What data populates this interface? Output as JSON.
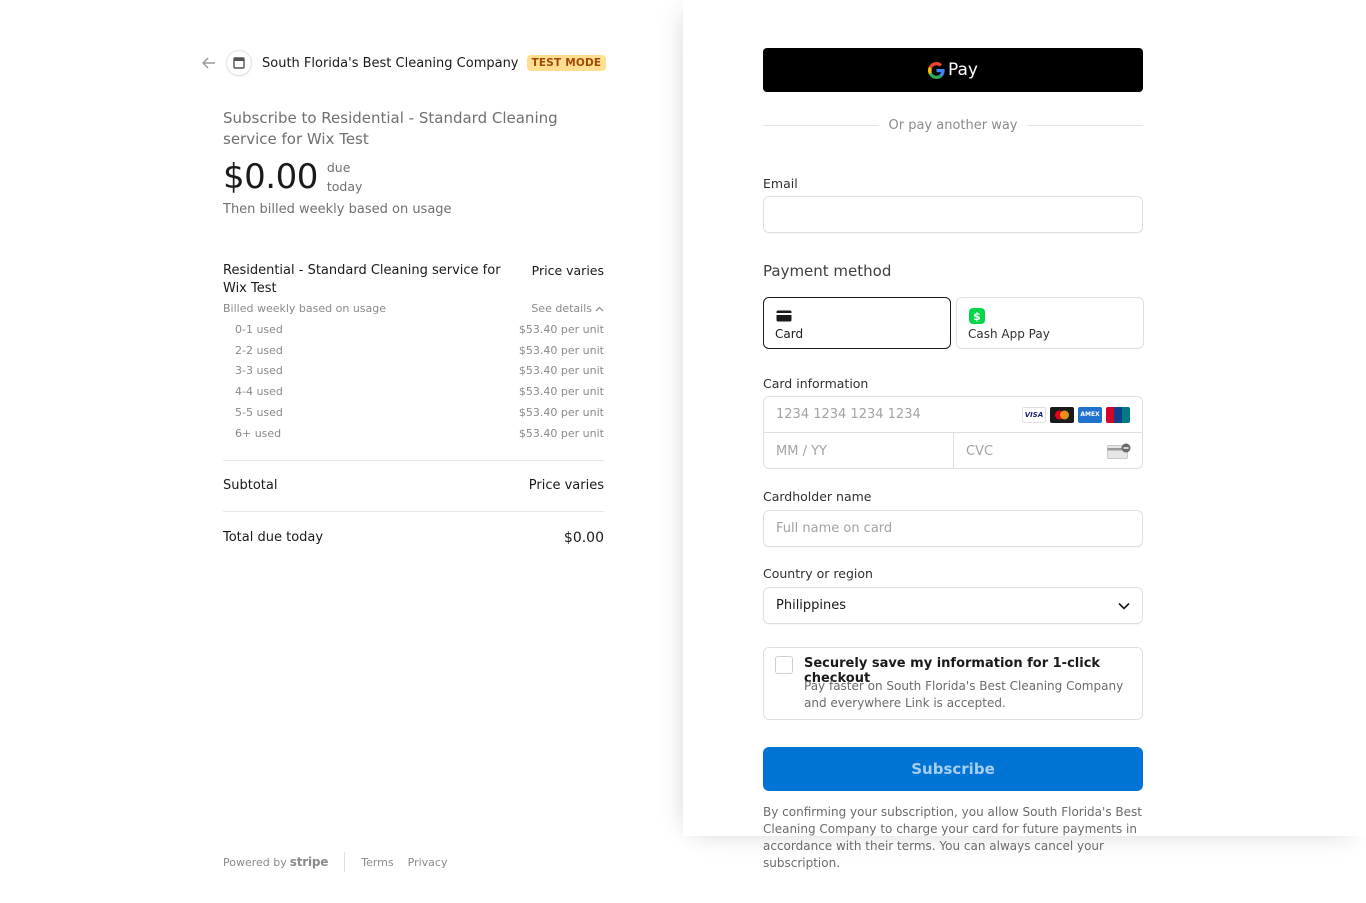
{
  "header": {
    "store_name": "South Florida's Best Cleaning Company",
    "badge": "TEST MODE"
  },
  "summary": {
    "title": "Subscribe to Residential - Standard Cleaning service for Wix Test",
    "price": "$0.00",
    "due_label": "due today",
    "billing_note": "Then billed weekly based on usage"
  },
  "line_item": {
    "name": "Residential - Standard Cleaning service for Wix Test",
    "price": "Price varies",
    "billing": "Billed weekly based on usage",
    "details_link": "See details",
    "tiers": [
      {
        "label": "0-1 used",
        "price": "$53.40 per unit"
      },
      {
        "label": "2-2 used",
        "price": "$53.40 per unit"
      },
      {
        "label": "3-3 used",
        "price": "$53.40 per unit"
      },
      {
        "label": "4-4 used",
        "price": "$53.40 per unit"
      },
      {
        "label": "5-5 used",
        "price": "$53.40 per unit"
      },
      {
        "label": "6+ used",
        "price": "$53.40 per unit"
      }
    ]
  },
  "totals": {
    "subtotal_label": "Subtotal",
    "subtotal_value": "Price varies",
    "total_label": "Total due today",
    "total_value": "$0.00"
  },
  "footer": {
    "powered_by": "Powered by",
    "brand": "stripe",
    "terms": "Terms",
    "privacy": "Privacy"
  },
  "checkout": {
    "gpay_label": "Pay",
    "divider_text": "Or pay another way",
    "email_label": "Email",
    "email_value": "",
    "payment_method_title": "Payment method",
    "methods": [
      {
        "label": "Card",
        "selected": true
      },
      {
        "label": "Cash App Pay",
        "selected": false
      }
    ],
    "card_info_label": "Card information",
    "card_number_placeholder": "1234 1234 1234 1234",
    "expiry_placeholder": "MM / YY",
    "cvc_placeholder": "CVC",
    "cardholder_label": "Cardholder name",
    "cardholder_placeholder": "Full name on card",
    "country_label": "Country or region",
    "country_value": "Philippines",
    "save_title": "Securely save my information for 1-click checkout",
    "save_desc": "Pay faster on South Florida's Best Cleaning Company and everywhere Link is accepted.",
    "subscribe_label": "Subscribe",
    "legal_text": "By confirming your subscription, you allow South Florida's Best Cleaning Company to charge your card for future payments in accordance with their terms. You can always cancel your subscription."
  },
  "colors": {
    "accent": "#0074d4",
    "badge_bg": "#ffde92",
    "badge_text": "#a04a03",
    "cashapp": "#00d54b"
  }
}
